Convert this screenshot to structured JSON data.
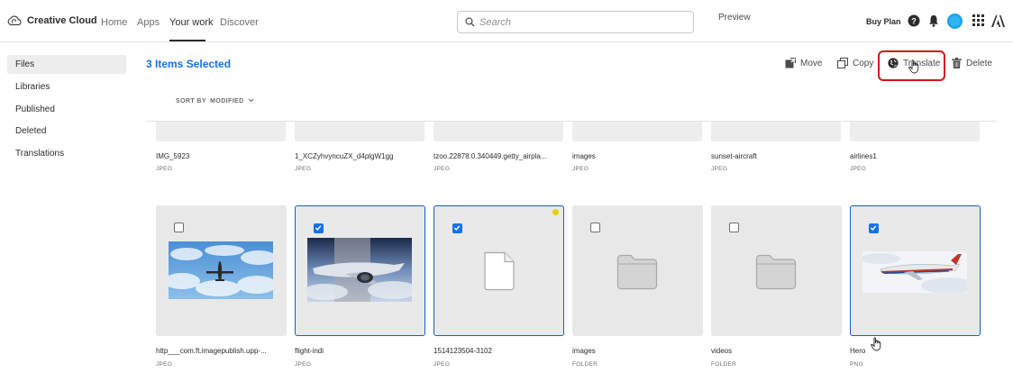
{
  "app": {
    "brand": "Creative Cloud",
    "nav": [
      "Home",
      "Apps",
      "Your work",
      "Discover"
    ],
    "search_placeholder": "Search",
    "preview": "Preview",
    "buy_plan": "Buy Plan"
  },
  "sidebar": {
    "items": [
      "Files",
      "Libraries",
      "Published",
      "Deleted",
      "Translations"
    ]
  },
  "actions": {
    "selected": "3 Items Selected",
    "move": "Move",
    "copy": "Copy",
    "translate": "Translate",
    "delete": "Delete"
  },
  "sort": {
    "label": "SORT BY",
    "value": "MODIFIED"
  },
  "row1": [
    {
      "name": "IMG_5923",
      "type": "JPEG"
    },
    {
      "name": "1_XCZyhvyncuZX_d4plgW1gg",
      "type": "JPEG"
    },
    {
      "name": "tzoo.22878.0.340449.getty_airpla...",
      "type": "JPEG"
    },
    {
      "name": "images",
      "type": "JPEG"
    },
    {
      "name": "sunset-aircraft",
      "type": "JPEG"
    },
    {
      "name": "airlines1",
      "type": "JPEG"
    }
  ],
  "row2": [
    {
      "name": "http___com.ft.imagepublish.upp-...",
      "type": "JPEG",
      "selected": false,
      "kind": "sky-plane"
    },
    {
      "name": "flight-indi",
      "type": "JPEG",
      "selected": true,
      "kind": "jet"
    },
    {
      "name": "1514123504-3102",
      "type": "JPEG",
      "selected": true,
      "kind": "file"
    },
    {
      "name": "images",
      "type": "FOLDER",
      "selected": false,
      "kind": "folder"
    },
    {
      "name": "videos",
      "type": "FOLDER",
      "selected": false,
      "kind": "folder"
    },
    {
      "name": "Hero",
      "type": "PNG",
      "selected": true,
      "kind": "airliner"
    }
  ],
  "colors": {
    "accent": "#1473e6",
    "highlight_ring": "#d7141a",
    "selected_border": "#1b5fc1"
  }
}
